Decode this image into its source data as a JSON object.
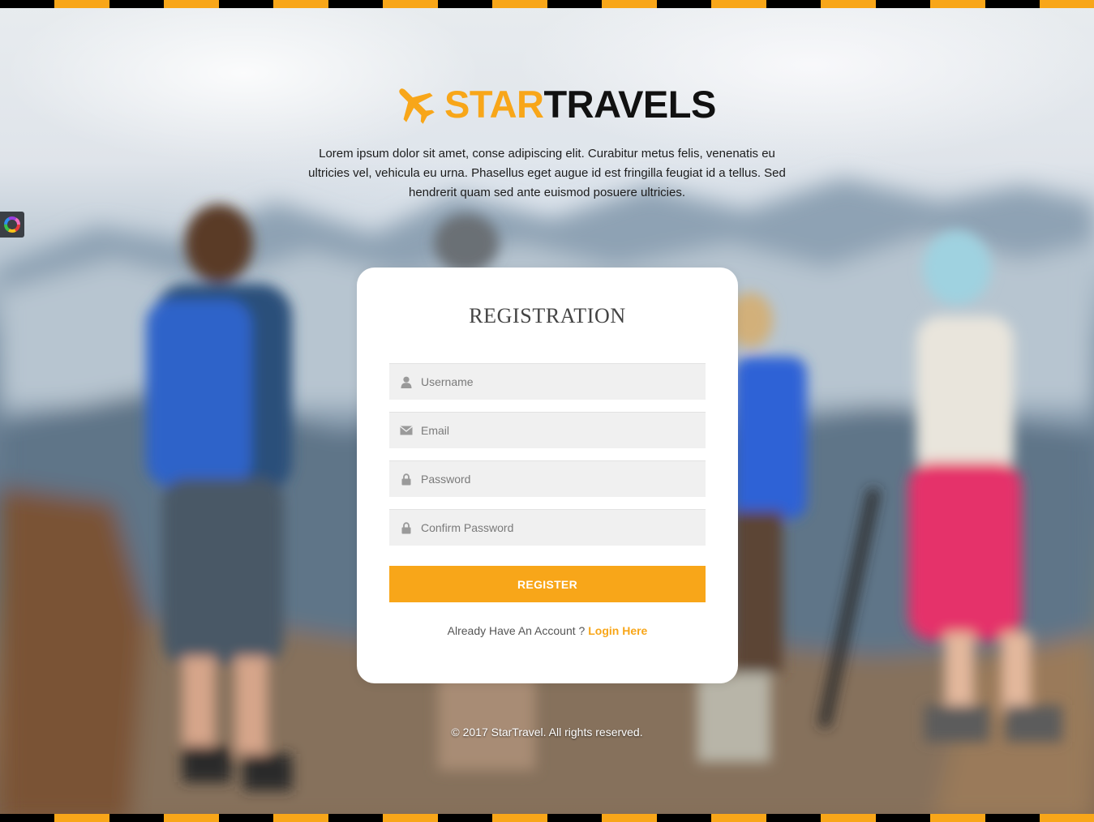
{
  "brand": {
    "star": "STAR",
    "travels": "TRAVELS",
    "icon": "airplane-icon",
    "accent_color": "#f8a619"
  },
  "intro": {
    "text": "Lorem ipsum dolor sit amet, conse adipiscing elit. Curabitur metus felis, venenatis eu ultricies vel, vehicula eu urna. Phasellus eget augue id est fringilla feugiat id a tellus. Sed hendrerit quam sed ante euismod posuere ultricies."
  },
  "form": {
    "title": "REGISTRATION",
    "fields": [
      {
        "placeholder": "Username",
        "value": "",
        "icon": "user-icon"
      },
      {
        "placeholder": "Email",
        "value": "",
        "icon": "envelope-icon"
      },
      {
        "placeholder": "Password",
        "value": "",
        "icon": "lock-icon"
      },
      {
        "placeholder": "Confirm Password",
        "value": "",
        "icon": "lock-icon"
      }
    ],
    "submit_label": "REGISTER",
    "account_prompt": "Already Have An Account ?",
    "login_link": "Login Here"
  },
  "footer": {
    "text": "© 2017 StarTravel. All rights reserved."
  },
  "side_tab": {
    "icon": "color-wheel-icon"
  }
}
